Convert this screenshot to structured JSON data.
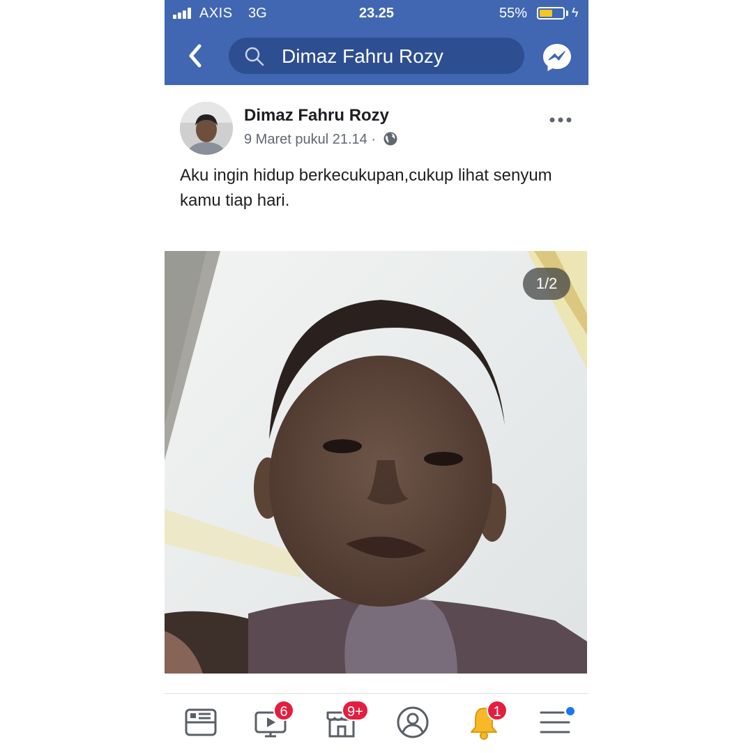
{
  "status_bar": {
    "carrier": "AXIS",
    "network": "3G",
    "time": "23.25",
    "battery_percent": "55%",
    "battery_level": 0.55,
    "battery_color": "#f3c623"
  },
  "header": {
    "back_icon": "chevron-left-icon",
    "search_icon": "search-icon",
    "search_text": "Dimaz Fahru Rozy",
    "messenger_icon": "messenger-icon",
    "background_color": "#4167b2"
  },
  "post": {
    "author": "Dimaz Fahru Rozy",
    "date": "9 Maret pukul 21.14 ·",
    "privacy_icon": "globe-icon",
    "more_icon": "more-horizontal-icon",
    "text": "Aku ingin hidup berkecukupan,cukup lihat senyum kamu tiap hari.",
    "photo_counter": "1/2"
  },
  "bottom_nav": {
    "items": [
      {
        "icon": "news-feed-icon",
        "badge": ""
      },
      {
        "icon": "watch-icon",
        "badge": "6"
      },
      {
        "icon": "marketplace-icon",
        "badge": "9+"
      },
      {
        "icon": "profile-icon",
        "badge": ""
      },
      {
        "icon": "notifications-bell-icon",
        "badge": "1"
      },
      {
        "icon": "menu-icon",
        "badge": ""
      }
    ],
    "badge_color": "#e41e3f",
    "menu_dot_color": "#1877f2"
  }
}
